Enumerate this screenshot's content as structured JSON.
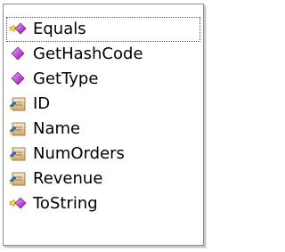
{
  "members": [
    {
      "label": "Equals",
      "icon": "extension-method-icon",
      "selected": true
    },
    {
      "label": "GetHashCode",
      "icon": "method-icon"
    },
    {
      "label": "GetType",
      "icon": "method-icon"
    },
    {
      "label": "ID",
      "icon": "property-icon"
    },
    {
      "label": "Name",
      "icon": "property-icon"
    },
    {
      "label": "NumOrders",
      "icon": "property-icon"
    },
    {
      "label": "Revenue",
      "icon": "property-icon"
    },
    {
      "label": "ToString",
      "icon": "extension-method-icon"
    }
  ],
  "colors": {
    "method": "#c24cd6",
    "property_card": "#d9c08a",
    "property_arrow": "#2d6fc2"
  }
}
